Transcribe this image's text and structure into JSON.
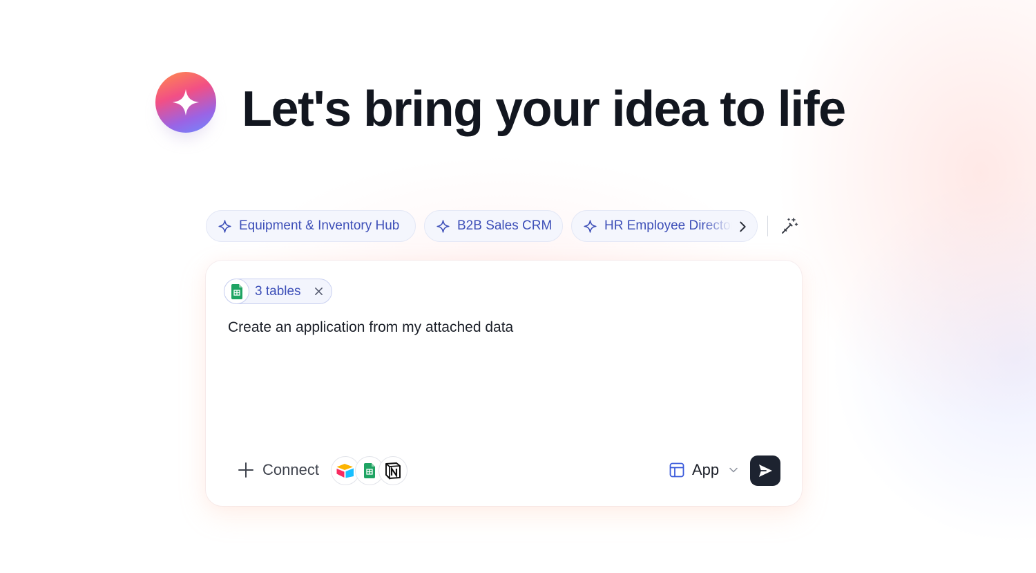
{
  "hero": {
    "title": "Let's bring your idea to life",
    "logo_icon": "sparkle-icon"
  },
  "suggestions": {
    "items": [
      {
        "label": "Equipment & Inventory Hub",
        "icon": "sparkle-outline-icon"
      },
      {
        "label": "B2B Sales CRM",
        "icon": "sparkle-outline-icon"
      },
      {
        "label": "HR Employee Directory",
        "icon": "sparkle-outline-icon"
      }
    ],
    "next_icon": "chevron-right-icon",
    "magic_icon": "magic-wand-icon"
  },
  "prompt": {
    "attachment": {
      "label": "3 tables",
      "icon": "google-sheets-icon",
      "remove_icon": "close-icon"
    },
    "text": "Create an application from my attached data",
    "connect_label": "Connect",
    "integrations": [
      "airtable-icon",
      "google-sheets-icon",
      "notion-icon"
    ],
    "mode": {
      "label": "App",
      "icon": "layout-icon"
    },
    "send_icon": "send-icon"
  },
  "colors": {
    "accent": "#3d4fb8",
    "chip_bg": "#f4f6fd",
    "send_bg": "#1d2330",
    "title": "#12161f"
  }
}
